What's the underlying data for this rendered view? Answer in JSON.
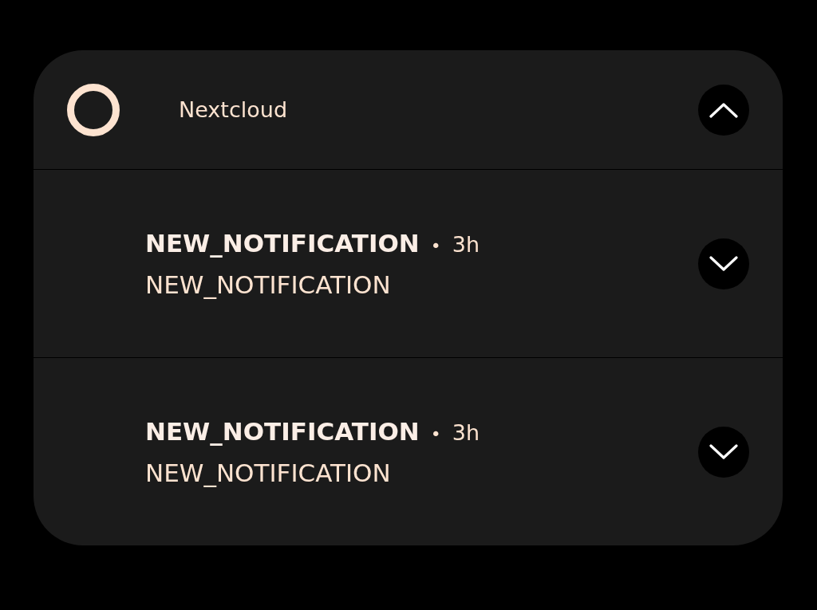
{
  "group": {
    "app_name": "Nextcloud",
    "expanded": true
  },
  "notifications": [
    {
      "title": "NEW_NOTIFICATION",
      "separator": "•",
      "time": "3h",
      "body": "NEW_NOTIFICATION",
      "expanded": false
    },
    {
      "title": "NEW_NOTIFICATION",
      "separator": "•",
      "time": "3h",
      "body": "NEW_NOTIFICATION",
      "expanded": false
    }
  ]
}
